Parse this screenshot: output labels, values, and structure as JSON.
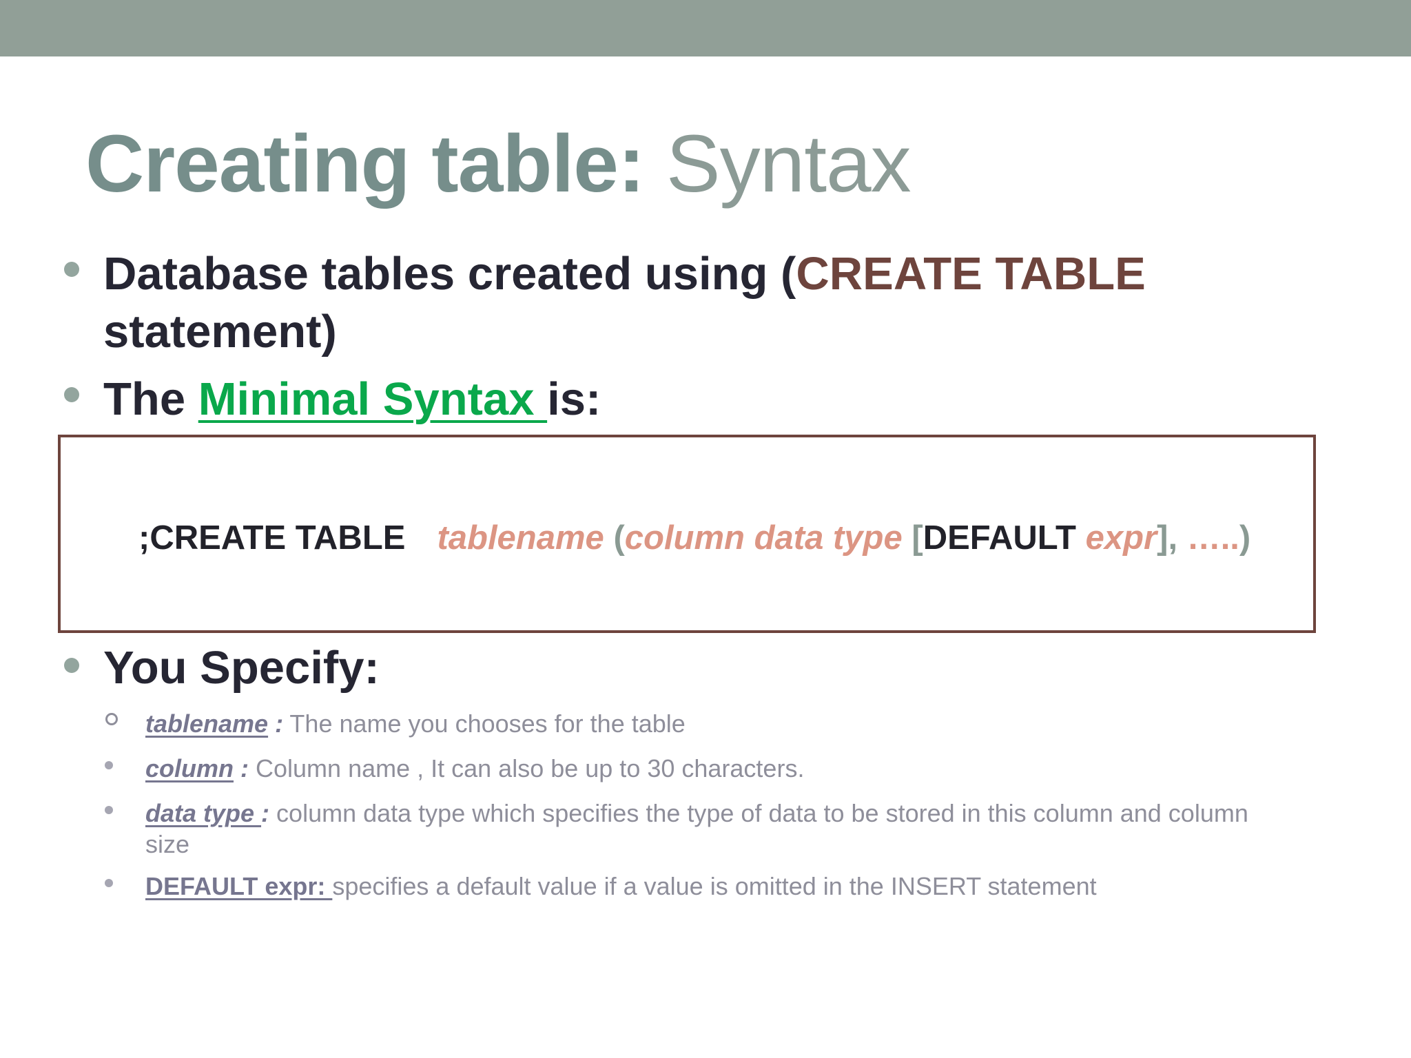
{
  "slide": {
    "title_bold": "Creating table:",
    "title_light": " Syntax"
  },
  "bullets": [
    {
      "text_before": "Database tables created using (",
      "highlight": "CREATE TABLE",
      "text_after": "statement)"
    },
    {
      "text_before": "The ",
      "highlight": "Minimal Syntax ",
      "text_after": "is:"
    }
  ],
  "syntax": {
    "semicolon_keyword": ";CREATE  TABLE",
    "tablename": "tablename",
    "open_paren": "(",
    "column_data_type": "column data type",
    "open_bracket": "[",
    "default_keyword": "DEFAULT",
    "expr": "expr",
    "close_bracket": "]",
    "comma": ",",
    "dots": " …..",
    "close_paren": ")"
  },
  "specify": {
    "heading": "You Specify:",
    "items": [
      {
        "term": "tablename",
        "sep": " :",
        "desc": " The name you chooses for the table"
      },
      {
        "term": "column",
        "sep": " :",
        "desc": " Column name , It can also be up to 30 characters."
      },
      {
        "term": "data type ",
        "sep": ":",
        "desc": " column data type  which specifies the type of data to be stored in this column and  column",
        "desc2": "size"
      },
      {
        "term": "DEFAULT expr: ",
        "desc": "specifies a default value if a value is omitted in the  INSERT statement"
      }
    ]
  },
  "colors": {
    "header_bar": "#919f97",
    "accent_red": "#6e443d",
    "accent_green": "#0aa84b",
    "syntax_salmon": "#dc9583"
  }
}
